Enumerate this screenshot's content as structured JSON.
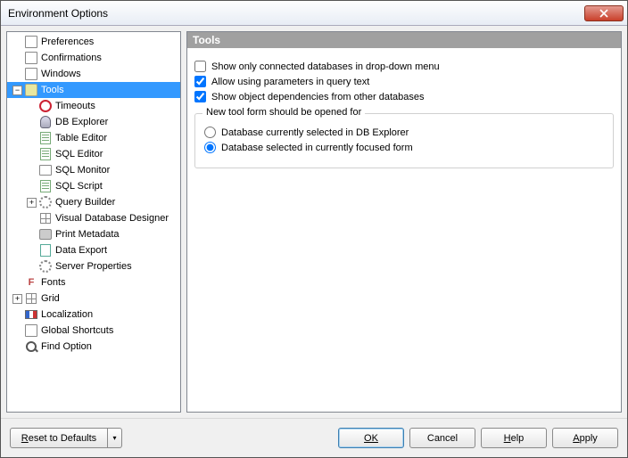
{
  "window": {
    "title": "Environment Options"
  },
  "tree": [
    {
      "label": "Preferences",
      "indent": 0,
      "expander": "none",
      "icon": "ico-box"
    },
    {
      "label": "Confirmations",
      "indent": 0,
      "expander": "none",
      "icon": "ico-box"
    },
    {
      "label": "Windows",
      "indent": 0,
      "expander": "none",
      "icon": "ico-box"
    },
    {
      "label": "Tools",
      "indent": 0,
      "expander": "minus",
      "icon": "ico-tool",
      "selected": true
    },
    {
      "label": "Timeouts",
      "indent": 1,
      "expander": "none",
      "icon": "ico-clock"
    },
    {
      "label": "DB Explorer",
      "indent": 1,
      "expander": "none",
      "icon": "ico-db"
    },
    {
      "label": "Table Editor",
      "indent": 1,
      "expander": "none",
      "icon": "ico-sheet"
    },
    {
      "label": "SQL Editor",
      "indent": 1,
      "expander": "none",
      "icon": "ico-sheet"
    },
    {
      "label": "SQL Monitor",
      "indent": 1,
      "expander": "none",
      "icon": "ico-monitor"
    },
    {
      "label": "SQL Script",
      "indent": 1,
      "expander": "none",
      "icon": "ico-sheet"
    },
    {
      "label": "Query Builder",
      "indent": 1,
      "expander": "plus",
      "icon": "ico-gear"
    },
    {
      "label": "Visual Database Designer",
      "indent": 1,
      "expander": "none",
      "icon": "ico-grid"
    },
    {
      "label": "Print Metadata",
      "indent": 1,
      "expander": "none",
      "icon": "ico-print"
    },
    {
      "label": "Data Export",
      "indent": 1,
      "expander": "none",
      "icon": "ico-export"
    },
    {
      "label": "Server Properties",
      "indent": 1,
      "expander": "none",
      "icon": "ico-gear"
    },
    {
      "label": "Fonts",
      "indent": 0,
      "expander": "none",
      "icon": "ico-font",
      "iconText": "F"
    },
    {
      "label": "Grid",
      "indent": 0,
      "expander": "plus",
      "icon": "ico-grid"
    },
    {
      "label": "Localization",
      "indent": 0,
      "expander": "none",
      "icon": "ico-flag"
    },
    {
      "label": "Global Shortcuts",
      "indent": 0,
      "expander": "none",
      "icon": "ico-box"
    },
    {
      "label": "Find Option",
      "indent": 0,
      "expander": "none",
      "icon": "ico-search"
    }
  ],
  "panel": {
    "title": "Tools",
    "checkboxes": [
      {
        "label": "Show only connected databases in drop-down menu",
        "checked": false
      },
      {
        "label": "Allow using parameters in query text",
        "checked": true
      },
      {
        "label": "Show object dependencies from other databases",
        "checked": true
      }
    ],
    "group": {
      "legend": "New tool form should be opened for",
      "radios": [
        {
          "label": "Database currently selected in DB Explorer",
          "checked": false
        },
        {
          "label": "Database selected in currently focused form",
          "checked": true
        }
      ]
    }
  },
  "buttons": {
    "reset": "Reset to Defaults",
    "ok": "OK",
    "cancel": "Cancel",
    "help": "Help",
    "apply": "Apply"
  }
}
